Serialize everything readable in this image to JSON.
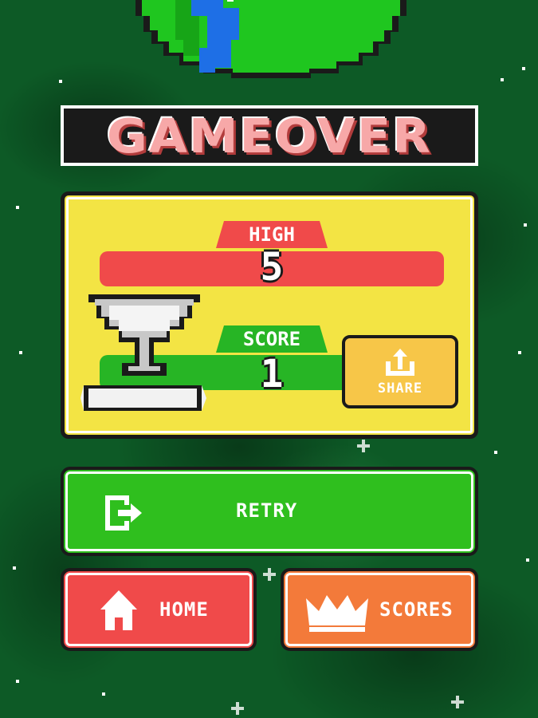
{
  "title": "GAMEOVER",
  "panel": {
    "high_label": "HIGH",
    "high_value": "5",
    "score_label": "SCORE",
    "score_value": "1",
    "share_label": "SHARE"
  },
  "buttons": {
    "retry_label": "RETRY",
    "home_label": "HOME",
    "scores_label": "SCORES"
  },
  "colors": {
    "background": "#0d5a26",
    "panel": "#f3e444",
    "high": "#f04a4a",
    "score": "#27b525",
    "share": "#f7c648",
    "retry": "#2fbf1e",
    "home": "#f04a4a",
    "scores": "#f37a3a",
    "title": "#f7a8a8"
  },
  "icons": {
    "retry": "exit-door-icon",
    "home": "house-icon",
    "scores": "crown-icon",
    "share": "upload-icon",
    "trophy": "trophy-icon"
  }
}
